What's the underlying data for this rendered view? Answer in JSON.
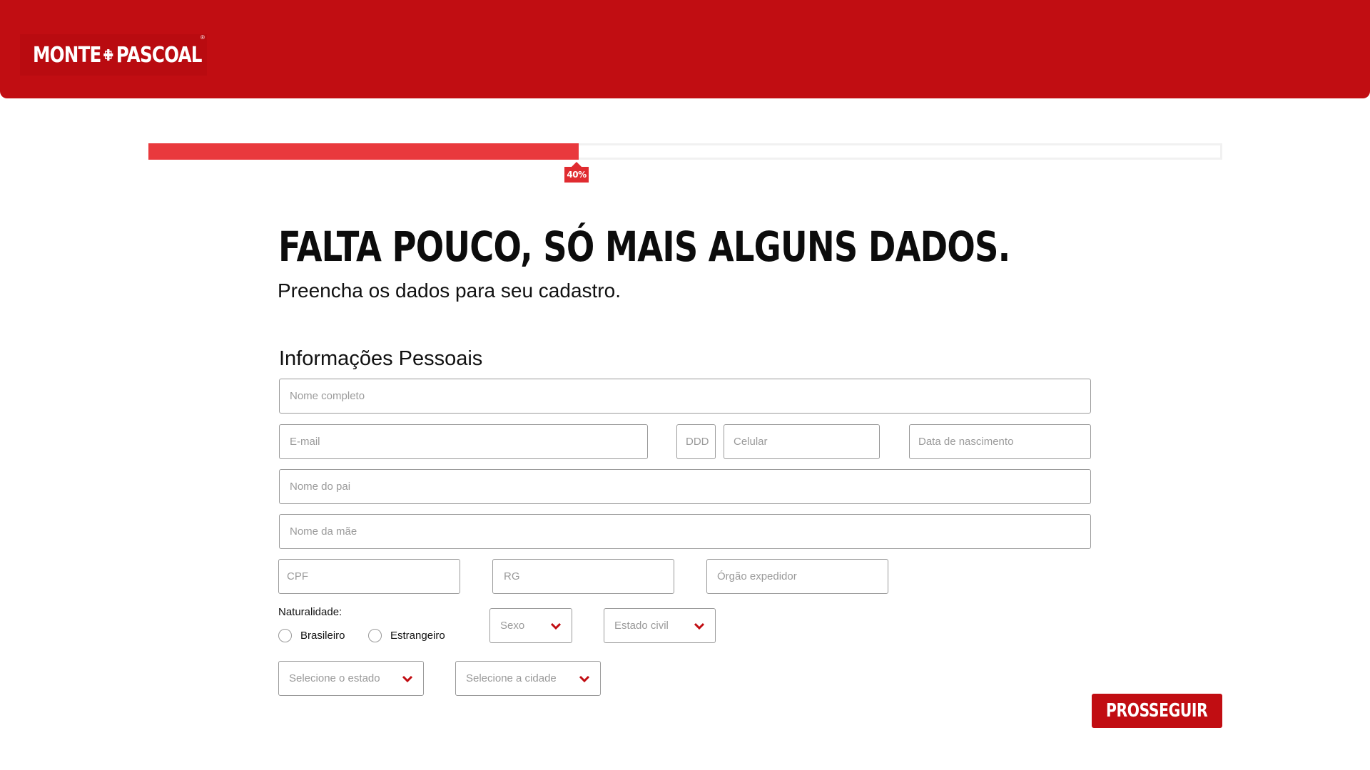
{
  "header": {
    "logo_text_left": "MONTE",
    "logo_text_right": "PASCOAL",
    "logo_registered": "®",
    "background_color": "#c10d12"
  },
  "progress": {
    "percent": 40,
    "label": "40%",
    "fill_color": "#e9393d"
  },
  "hero": {
    "title": "FALTA POUCO, SÓ MAIS ALGUNS DADOS.",
    "subtitle": "Preencha os dados para seu cadastro."
  },
  "form": {
    "section_title": "Informações Pessoais",
    "placeholders": {
      "full_name": "Nome completo",
      "email": "E-mail",
      "ddd": "DDD",
      "phone": "Celular",
      "birth_date": "Data de nascimento",
      "father_name": "Nome do pai",
      "mother_name": "Nome da mãe",
      "cpf": "CPF",
      "rg": "RG",
      "issuer": "Órgão expedidor"
    },
    "naturality": {
      "label": "Naturalidade:",
      "options": [
        "Brasileiro",
        "Estrangeiro"
      ]
    },
    "selects": {
      "sex": "Sexo",
      "marital_status": "Estado civil",
      "state": "Selecione o estado",
      "city": "Selecione a cidade"
    },
    "submit_label": "PROSSEGUIR"
  },
  "icons": {
    "logo": "cross-logo-icon",
    "dropdown": "chevron-down-icon",
    "accent_color": "#c10d12"
  }
}
